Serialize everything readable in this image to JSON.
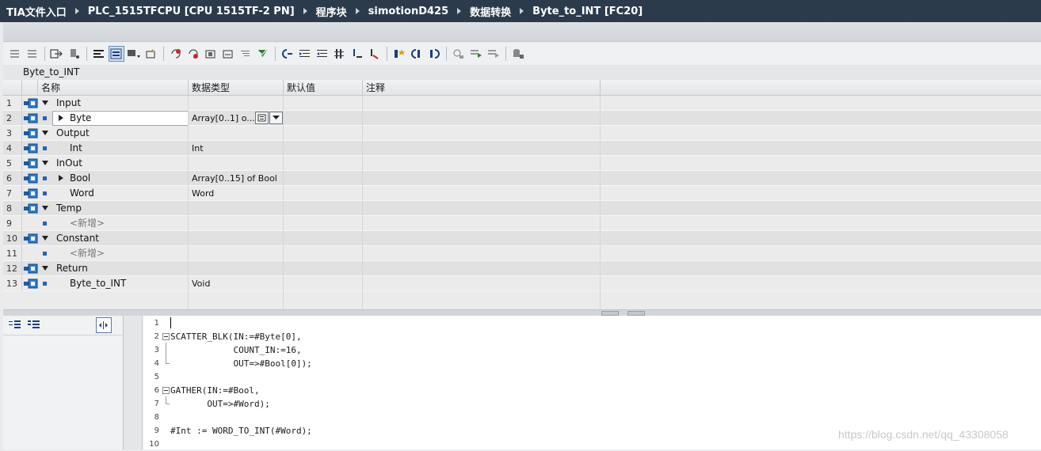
{
  "breadcrumb": [
    "TIA文件入口",
    "PLC_1515TFCPU [CPU 1515TF-2 PN]",
    "程序块",
    "simotionD425",
    "数据转换",
    "Byte_to_INT [FC20]"
  ],
  "block_title": "Byte_to_INT",
  "columns": {
    "name": "名称",
    "datatype": "数据类型",
    "default": "默认值",
    "comment": "注释"
  },
  "rows": [
    {
      "num": "1",
      "name": "Input",
      "type": "",
      "kind": "section"
    },
    {
      "num": "2",
      "name": "Byte",
      "type": "Array[0..1] o...",
      "kind": "member-expandable",
      "selected": true
    },
    {
      "num": "3",
      "name": "Output",
      "type": "",
      "kind": "section"
    },
    {
      "num": "4",
      "name": "Int",
      "type": "Int",
      "kind": "member"
    },
    {
      "num": "5",
      "name": "InOut",
      "type": "",
      "kind": "section"
    },
    {
      "num": "6",
      "name": "Bool",
      "type": "Array[0..15] of Bool",
      "kind": "member-expandable"
    },
    {
      "num": "7",
      "name": "Word",
      "type": "Word",
      "kind": "member"
    },
    {
      "num": "8",
      "name": "Temp",
      "type": "",
      "kind": "section"
    },
    {
      "num": "9",
      "name": "<新增>",
      "type": "",
      "kind": "addnew"
    },
    {
      "num": "10",
      "name": "Constant",
      "type": "",
      "kind": "section"
    },
    {
      "num": "11",
      "name": "<新增>",
      "type": "",
      "kind": "addnew"
    },
    {
      "num": "12",
      "name": "Return",
      "type": "",
      "kind": "section"
    },
    {
      "num": "13",
      "name": "Byte_to_INT",
      "type": "Void",
      "kind": "member"
    }
  ],
  "code_lines": [
    {
      "num": "1",
      "text": ""
    },
    {
      "num": "2",
      "text": "SCATTER_BLK(IN:=#Byte[0],"
    },
    {
      "num": "3",
      "text": "            COUNT_IN:=16,"
    },
    {
      "num": "4",
      "text": "            OUT=>#Bool[0]);"
    },
    {
      "num": "5",
      "text": ""
    },
    {
      "num": "6",
      "text": "GATHER(IN:=#Bool,"
    },
    {
      "num": "7",
      "text": "       OUT=>#Word);"
    },
    {
      "num": "8",
      "text": ""
    },
    {
      "num": "9",
      "text": "#Int := WORD_TO_INT(#Word);"
    },
    {
      "num": "10",
      "text": ""
    }
  ],
  "watermark": "https://blog.csdn.net/qq_43308058",
  "colors": {
    "titlebar": "#2c3b4c",
    "accent": "#2a5fb8",
    "editor_bg": "#ffffff"
  }
}
